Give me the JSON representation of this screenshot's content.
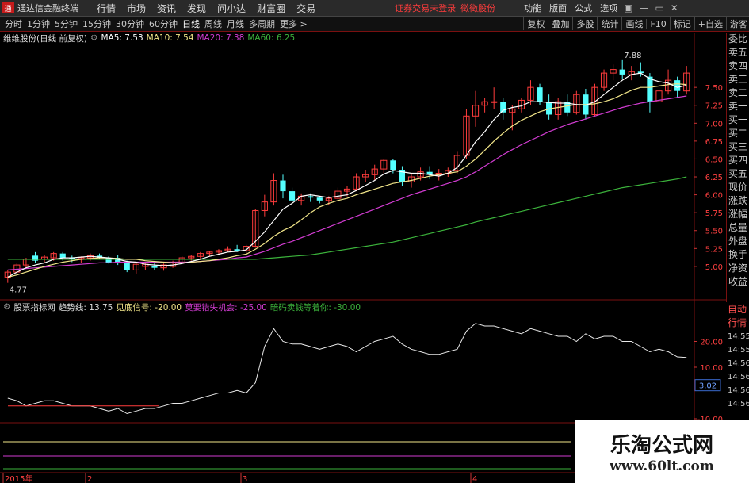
{
  "titlebar": {
    "logo": "通",
    "app_name": "通达信金融终端",
    "menus": [
      "行情",
      "市场",
      "资讯",
      "发现",
      "问小达",
      "财富圈",
      "交易"
    ],
    "login_status": "证券交易未登录",
    "stock_notice": "徵徵股份",
    "right_buttons": [
      "功能",
      "版面",
      "公式",
      "选项"
    ],
    "window_controls": [
      "▣",
      "—",
      "▭",
      "✕"
    ]
  },
  "toolbar": {
    "periods": [
      "分时",
      "1分钟",
      "5分钟",
      "15分钟",
      "30分钟",
      "60分钟",
      "日线",
      "周线",
      "月线",
      "多周期",
      "更多 >"
    ],
    "active_period": "日线",
    "right_buttons": [
      "复权",
      "叠加",
      "多股",
      "统计",
      "画线",
      "F10",
      "标记",
      "+自选",
      "游客"
    ]
  },
  "chart_info": {
    "stock": "维维股份(日线 前复权)",
    "ma5": "MA5: 7.53",
    "ma10": "MA10: 7.54",
    "ma20": "MA20: 7.38",
    "ma60": "MA60: 6.25",
    "colors": {
      "ma5": "#ffffff",
      "ma10": "#f2e68a",
      "ma20": "#d23cd2",
      "ma60": "#3cb43c"
    }
  },
  "side_panel": {
    "items": [
      "委比",
      "卖五",
      "卖四",
      "卖三",
      "卖二",
      "卖一",
      "买一",
      "买二",
      "买三",
      "买四",
      "买五",
      "现价",
      "涨跌",
      "涨幅",
      "总量",
      "外盘",
      "换手",
      "净资",
      "收益"
    ]
  },
  "side_panel_lower": {
    "items": [
      "自动",
      "行情",
      "14:55",
      "14:55",
      "14:56",
      "14:56",
      "14:56",
      "14:56"
    ]
  },
  "indicator_info": {
    "name": "股票指标网",
    "trend": "趋势线: 13.75",
    "bottom_signal": "见底信号: -20.00",
    "dont_miss": "莫要错失机会: -25.00",
    "wait": "暗码卖钱等着你: -30.00"
  },
  "price_axis": {
    "ticks": [
      7.5,
      7.25,
      7.0,
      6.75,
      6.5,
      6.25,
      6.0,
      5.75,
      5.5,
      5.25,
      5.0
    ],
    "ylim": [
      4.6,
      8.1
    ]
  },
  "annotations": {
    "high": "7.88",
    "low": "4.77"
  },
  "indicator_axis": {
    "ticks": [
      "20.00",
      "10.00",
      "3.02",
      "-10.00"
    ]
  },
  "date_axis": [
    "2015年",
    "2",
    "3",
    "4"
  ],
  "watermark": {
    "title": "乐淘公式网",
    "url": "www.60lt.com"
  },
  "chart_data": {
    "type": "candlestick",
    "candles": [
      [
        4.85,
        4.95,
        4.77,
        4.92
      ],
      [
        4.92,
        5.05,
        4.9,
        5.02
      ],
      [
        5.02,
        5.12,
        4.98,
        5.1
      ],
      [
        5.15,
        5.2,
        5.05,
        5.08
      ],
      [
        5.1,
        5.16,
        5.06,
        5.13
      ],
      [
        5.12,
        5.2,
        5.08,
        5.18
      ],
      [
        5.18,
        5.2,
        5.08,
        5.12
      ],
      [
        5.12,
        5.15,
        5.06,
        5.1
      ],
      [
        5.1,
        5.14,
        5.05,
        5.12
      ],
      [
        5.12,
        5.18,
        5.08,
        5.15
      ],
      [
        5.15,
        5.18,
        5.1,
        5.12
      ],
      [
        5.12,
        5.14,
        5.04,
        5.05
      ],
      [
        5.12,
        5.16,
        5.02,
        5.05
      ],
      [
        5.05,
        5.08,
        4.92,
        4.95
      ],
      [
        4.95,
        5.05,
        4.9,
        5.03
      ],
      [
        5.0,
        5.06,
        4.95,
        5.03
      ],
      [
        5.0,
        5.06,
        4.95,
        4.98
      ],
      [
        4.98,
        5.04,
        4.94,
        5.02
      ],
      [
        5.0,
        5.08,
        4.98,
        5.06
      ],
      [
        5.06,
        5.14,
        5.04,
        5.12
      ],
      [
        5.12,
        5.16,
        5.08,
        5.14
      ],
      [
        5.14,
        5.2,
        5.1,
        5.18
      ],
      [
        5.18,
        5.22,
        5.14,
        5.2
      ],
      [
        5.2,
        5.24,
        5.16,
        5.22
      ],
      [
        5.22,
        5.28,
        5.2,
        5.24
      ],
      [
        5.24,
        5.3,
        5.2,
        5.22
      ],
      [
        5.22,
        5.3,
        5.18,
        5.28
      ],
      [
        5.28,
        5.8,
        5.26,
        5.78
      ],
      [
        5.78,
        6.0,
        5.7,
        5.9
      ],
      [
        5.9,
        6.3,
        5.85,
        6.2
      ],
      [
        6.2,
        6.28,
        5.95,
        6.05
      ],
      [
        6.05,
        6.1,
        5.88,
        5.92
      ],
      [
        5.92,
        6.02,
        5.85,
        5.98
      ],
      [
        5.98,
        6.02,
        5.9,
        5.96
      ],
      [
        5.96,
        5.98,
        5.88,
        5.92
      ],
      [
        5.92,
        5.98,
        5.86,
        5.95
      ],
      [
        5.95,
        6.1,
        5.92,
        6.05
      ],
      [
        6.05,
        6.12,
        5.98,
        6.08
      ],
      [
        6.08,
        6.3,
        6.05,
        6.25
      ],
      [
        6.25,
        6.35,
        6.18,
        6.28
      ],
      [
        6.28,
        6.42,
        6.2,
        6.36
      ],
      [
        6.36,
        6.5,
        6.3,
        6.48
      ],
      [
        6.48,
        6.5,
        6.3,
        6.35
      ],
      [
        6.35,
        6.4,
        6.12,
        6.18
      ],
      [
        6.18,
        6.3,
        6.1,
        6.25
      ],
      [
        6.25,
        6.38,
        6.2,
        6.32
      ],
      [
        6.32,
        6.4,
        6.22,
        6.28
      ],
      [
        6.28,
        6.36,
        6.2,
        6.3
      ],
      [
        6.3,
        6.38,
        6.25,
        6.34
      ],
      [
        6.34,
        6.6,
        6.3,
        6.55
      ],
      [
        6.55,
        7.2,
        6.5,
        7.1
      ],
      [
        7.1,
        7.45,
        6.95,
        7.25
      ],
      [
        7.25,
        7.35,
        7.15,
        7.3
      ],
      [
        7.3,
        7.5,
        7.2,
        7.3
      ],
      [
        7.3,
        7.35,
        7.05,
        7.15
      ],
      [
        7.15,
        7.25,
        6.9,
        7.2
      ],
      [
        7.2,
        7.35,
        7.15,
        7.32
      ],
      [
        7.32,
        7.6,
        7.25,
        7.5
      ],
      [
        7.5,
        7.55,
        7.25,
        7.3
      ],
      [
        7.3,
        7.4,
        7.05,
        7.12
      ],
      [
        7.12,
        7.35,
        7.05,
        7.3
      ],
      [
        7.3,
        7.4,
        7.1,
        7.15
      ],
      [
        7.15,
        7.45,
        7.12,
        7.4
      ],
      [
        7.4,
        7.48,
        7.05,
        7.12
      ],
      [
        7.12,
        7.55,
        7.1,
        7.5
      ],
      [
        7.5,
        7.75,
        7.45,
        7.7
      ],
      [
        7.7,
        7.82,
        7.6,
        7.75
      ],
      [
        7.75,
        7.88,
        7.62,
        7.68
      ],
      [
        7.68,
        7.8,
        7.6,
        7.72
      ],
      [
        7.72,
        7.85,
        7.65,
        7.7
      ],
      [
        7.65,
        7.7,
        7.15,
        7.3
      ],
      [
        7.3,
        7.5,
        7.2,
        7.45
      ],
      [
        7.45,
        7.75,
        7.4,
        7.6
      ],
      [
        7.6,
        7.65,
        7.35,
        7.45
      ],
      [
        7.45,
        7.8,
        7.4,
        7.7
      ]
    ],
    "ma5": [
      4.85,
      4.92,
      4.98,
      5.02,
      5.05,
      5.1,
      5.12,
      5.12,
      5.13,
      5.14,
      5.13,
      5.12,
      5.1,
      5.07,
      5.06,
      5.03,
      5.02,
      5.01,
      5.02,
      5.04,
      5.07,
      5.1,
      5.14,
      5.17,
      5.2,
      5.21,
      5.23,
      5.35,
      5.48,
      5.64,
      5.8,
      5.88,
      5.98,
      6.0,
      5.98,
      5.96,
      5.98,
      6.0,
      6.06,
      6.13,
      6.2,
      6.29,
      6.34,
      6.32,
      6.3,
      6.3,
      6.28,
      6.26,
      6.3,
      6.38,
      6.55,
      6.74,
      6.88,
      7.05,
      7.18,
      7.22,
      7.24,
      7.3,
      7.3,
      7.29,
      7.28,
      7.28,
      7.26,
      7.25,
      7.3,
      7.4,
      7.5,
      7.6,
      7.68,
      7.7,
      7.62,
      7.58,
      7.56,
      7.5,
      7.53
    ],
    "ma10": [
      4.85,
      4.88,
      4.92,
      4.96,
      5.0,
      5.03,
      5.06,
      5.08,
      5.1,
      5.11,
      5.12,
      5.12,
      5.11,
      5.1,
      5.1,
      5.08,
      5.07,
      5.06,
      5.05,
      5.05,
      5.06,
      5.07,
      5.08,
      5.1,
      5.12,
      5.15,
      5.17,
      5.24,
      5.32,
      5.42,
      5.5,
      5.56,
      5.65,
      5.75,
      5.83,
      5.88,
      5.92,
      5.95,
      6.0,
      6.04,
      6.08,
      6.12,
      6.16,
      6.18,
      6.2,
      6.23,
      6.26,
      6.28,
      6.3,
      6.32,
      6.4,
      6.5,
      6.62,
      6.75,
      6.86,
      6.96,
      7.04,
      7.1,
      7.16,
      7.2,
      7.22,
      7.24,
      7.26,
      7.26,
      7.27,
      7.3,
      7.34,
      7.4,
      7.46,
      7.5,
      7.5,
      7.52,
      7.54,
      7.55,
      7.54
    ],
    "ma20": [
      4.95,
      4.96,
      4.97,
      4.98,
      4.99,
      5.0,
      5.01,
      5.02,
      5.03,
      5.04,
      5.05,
      5.05,
      5.06,
      5.06,
      5.06,
      5.06,
      5.06,
      5.06,
      5.06,
      5.06,
      5.06,
      5.07,
      5.08,
      5.09,
      5.1,
      5.12,
      5.13,
      5.17,
      5.21,
      5.26,
      5.31,
      5.35,
      5.4,
      5.45,
      5.5,
      5.55,
      5.6,
      5.65,
      5.7,
      5.75,
      5.8,
      5.85,
      5.9,
      5.95,
      6.0,
      6.04,
      6.08,
      6.12,
      6.16,
      6.2,
      6.25,
      6.32,
      6.4,
      6.48,
      6.56,
      6.63,
      6.7,
      6.76,
      6.82,
      6.88,
      6.93,
      6.98,
      7.02,
      7.06,
      7.1,
      7.14,
      7.18,
      7.22,
      7.25,
      7.28,
      7.3,
      7.32,
      7.34,
      7.36,
      7.38
    ],
    "ma60": [
      5.1,
      5.1,
      5.1,
      5.1,
      5.1,
      5.1,
      5.1,
      5.1,
      5.1,
      5.1,
      5.1,
      5.1,
      5.1,
      5.1,
      5.1,
      5.1,
      5.1,
      5.1,
      5.1,
      5.1,
      5.1,
      5.1,
      5.1,
      5.1,
      5.1,
      5.1,
      5.1,
      5.1,
      5.11,
      5.12,
      5.13,
      5.14,
      5.15,
      5.16,
      5.18,
      5.2,
      5.22,
      5.24,
      5.26,
      5.28,
      5.3,
      5.32,
      5.34,
      5.37,
      5.4,
      5.43,
      5.46,
      5.49,
      5.52,
      5.55,
      5.58,
      5.62,
      5.65,
      5.68,
      5.71,
      5.74,
      5.77,
      5.8,
      5.83,
      5.86,
      5.89,
      5.92,
      5.95,
      5.98,
      6.01,
      6.04,
      6.07,
      6.1,
      6.12,
      6.14,
      6.16,
      6.18,
      6.2,
      6.22,
      6.25
    ],
    "indicator": [
      -2,
      -3,
      -5,
      -4,
      -3,
      -3,
      -4,
      -5,
      -5,
      -5,
      -6,
      -7,
      -6,
      -8,
      -7,
      -6,
      -6,
      -5,
      -4,
      -4,
      -3,
      -2,
      -1,
      0,
      0,
      1,
      0,
      4,
      18,
      25,
      20,
      19,
      19,
      18,
      17,
      18,
      19,
      18,
      16,
      18,
      20,
      21,
      22,
      19,
      17,
      16,
      15,
      15,
      16,
      17,
      24,
      27,
      26,
      26,
      25,
      24,
      23,
      25,
      24,
      23,
      22,
      22,
      20,
      23,
      21,
      22,
      22,
      20,
      20,
      18,
      16,
      17,
      16,
      14,
      13.75
    ],
    "indicator_ylim": [
      -10,
      30
    ],
    "ref_lines": [
      {
        "name": "见底信号",
        "value": -20
      },
      {
        "name": "莫要错失机会",
        "value": -25
      },
      {
        "name": "暗码卖钱等着你",
        "value": -30
      }
    ]
  }
}
